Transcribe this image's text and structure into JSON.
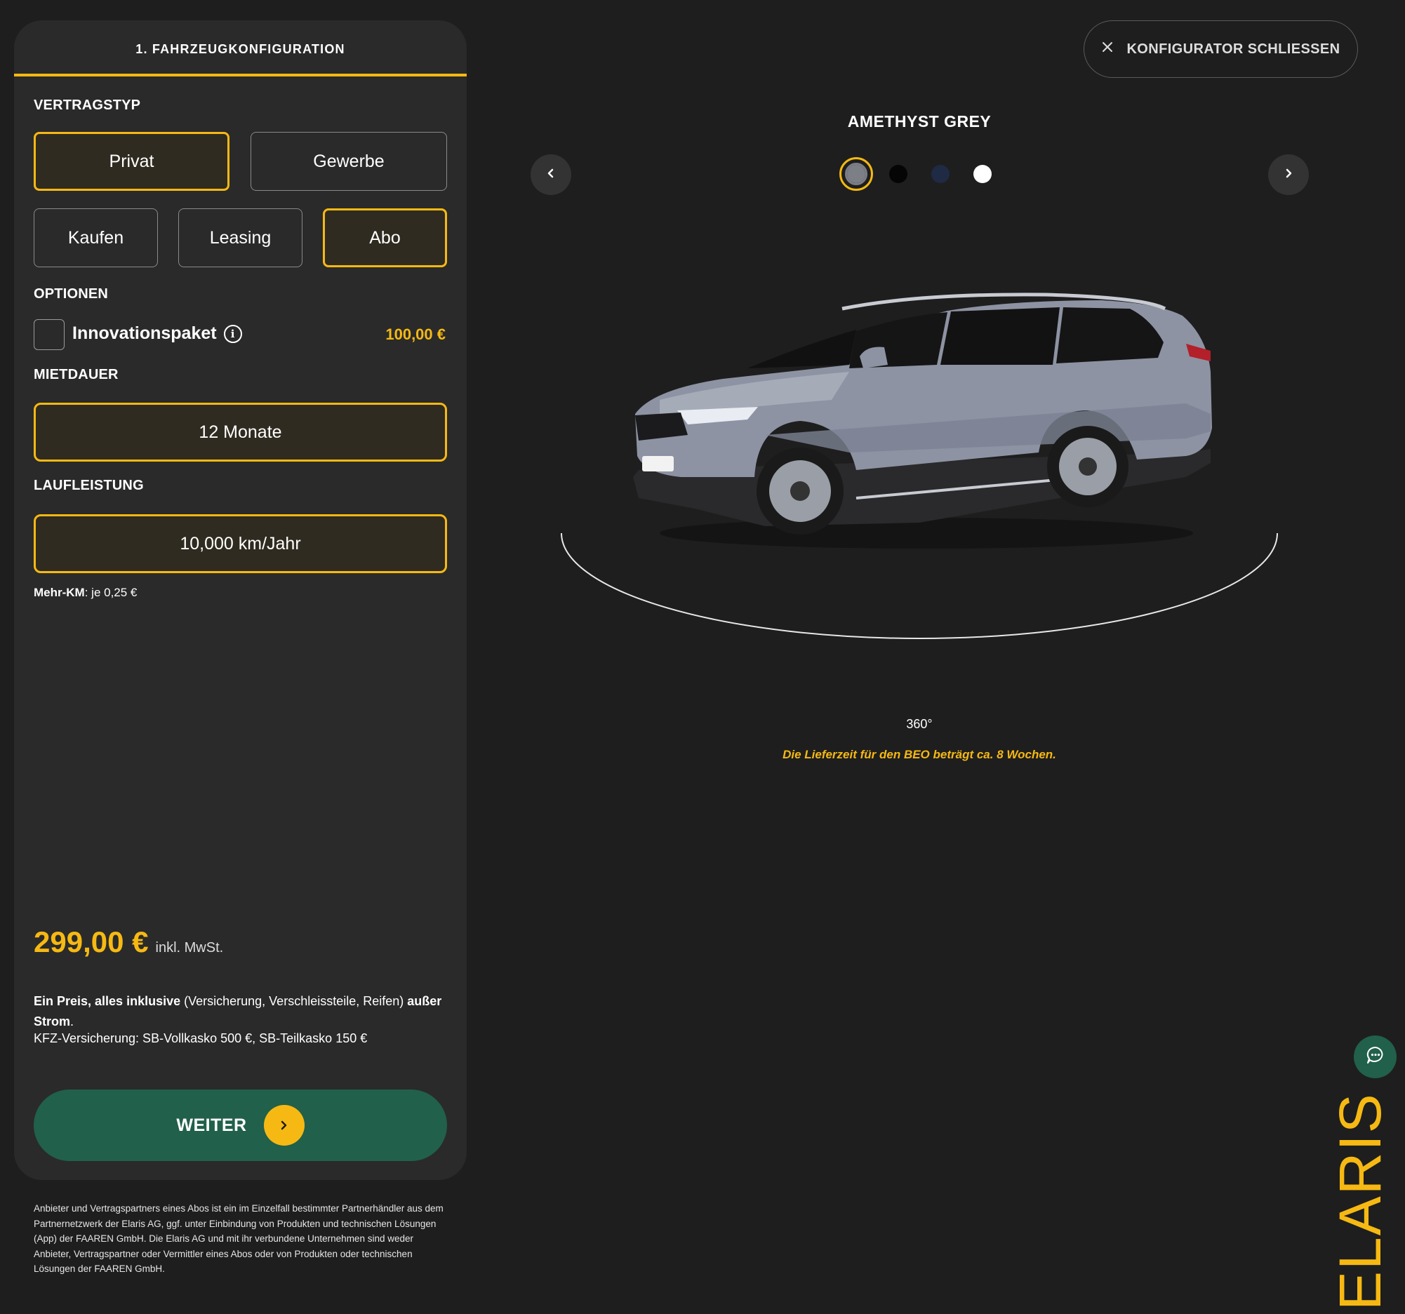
{
  "panel": {
    "header": "1. FAHRZEUGKONFIGURATION",
    "vertragstyp": {
      "label": "VERTRAGSTYP",
      "customer_types": [
        "Privat",
        "Gewerbe"
      ],
      "selected_customer_type": "Privat",
      "contract_types": [
        "Kaufen",
        "Leasing",
        "Abo"
      ],
      "selected_contract_type": "Abo"
    },
    "optionen": {
      "label": "OPTIONEN",
      "option_name": "Innovationspaket",
      "info_icon": "info-icon",
      "option_price": "100,00 €",
      "checked": false
    },
    "mietdauer": {
      "label": "MIETDAUER",
      "value": "12 Monate"
    },
    "laufleistung": {
      "label": "LAUFLEISTUNG",
      "value": "10,000 km/Jahr",
      "mehr_km_label": "Mehr-KM",
      "mehr_km_value": ": je 0,25 €"
    },
    "price": {
      "amount": "299,00 €",
      "note": "inkl. MwSt."
    },
    "inclusive": {
      "bold1": "Ein Preis, alles inklusive",
      "text1": " (Versicherung, Verschleissteile, Reifen) ",
      "bold2": "außer Strom",
      "text2": "."
    },
    "insurance": "KFZ-Versicherung: SB-Vollkasko 500 €, SB-Teilkasko 150 €",
    "next_button": {
      "label": "WEITER",
      "icon": "chevron-right-icon"
    }
  },
  "disclaimer": "Anbieter und Vertragspartners eines Abos ist ein im Einzelfall bestimmter Partnerhändler aus dem Partnernetzwerk der Elaris AG, ggf. unter Einbindung von Produkten und technischen Lösungen (App) der FAAREN GmbH. Die Elaris AG und mit ihr verbundene Unternehmen sind weder Anbieter, Vertragspartner oder Vermittler eines Abos oder von Produkten oder technischen Lösungen der FAAREN GmbH.",
  "viewer": {
    "close_button": "KONFIGURATOR SCHLIESSEN",
    "color_name": "AMETHYST GREY",
    "colors": [
      "#7d7f86",
      "#050505",
      "#1f2a44",
      "#ffffff"
    ],
    "selected_color_index": 0,
    "rotation_label": "360°",
    "delivery_note": "Die Lieferzeit für den BEO beträgt ca. 8 Wochen."
  },
  "brand": "ELARIS",
  "accent_color": "#f6b913",
  "button_green": "#21604a"
}
